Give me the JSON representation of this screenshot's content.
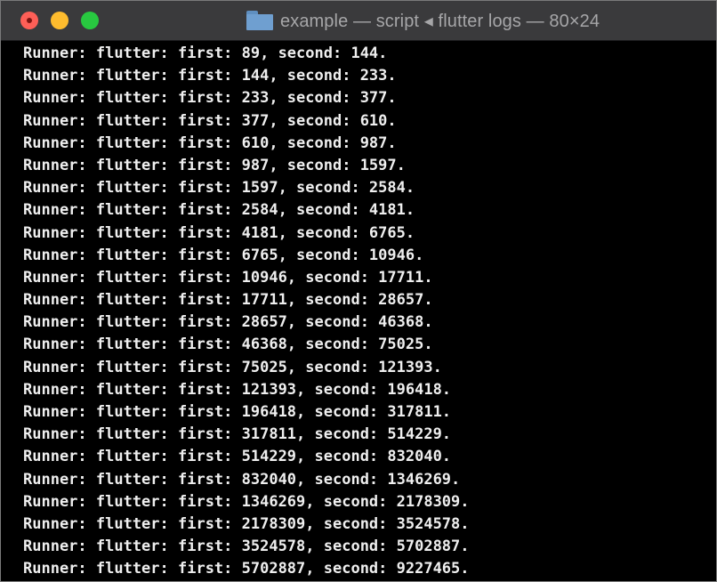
{
  "window": {
    "title": "example — script ◂ flutter logs — 80×24",
    "title_icon": "folder-icon",
    "traffic_lights": {
      "close_color": "#fe5f57",
      "minimize_color": "#febc2e",
      "zoom_color": "#28c840"
    }
  },
  "terminal": {
    "background": "#000000",
    "foreground": "#efefef",
    "lines": [
      "Runner: flutter: first: 89, second: 144.",
      "Runner: flutter: first: 144, second: 233.",
      "Runner: flutter: first: 233, second: 377.",
      "Runner: flutter: first: 377, second: 610.",
      "Runner: flutter: first: 610, second: 987.",
      "Runner: flutter: first: 987, second: 1597.",
      "Runner: flutter: first: 1597, second: 2584.",
      "Runner: flutter: first: 2584, second: 4181.",
      "Runner: flutter: first: 4181, second: 6765.",
      "Runner: flutter: first: 6765, second: 10946.",
      "Runner: flutter: first: 10946, second: 17711.",
      "Runner: flutter: first: 17711, second: 28657.",
      "Runner: flutter: first: 28657, second: 46368.",
      "Runner: flutter: first: 46368, second: 75025.",
      "Runner: flutter: first: 75025, second: 121393.",
      "Runner: flutter: first: 121393, second: 196418.",
      "Runner: flutter: first: 196418, second: 317811.",
      "Runner: flutter: first: 317811, second: 514229.",
      "Runner: flutter: first: 514229, second: 832040.",
      "Runner: flutter: first: 832040, second: 1346269.",
      "Runner: flutter: first: 1346269, second: 2178309.",
      "Runner: flutter: first: 2178309, second: 3524578.",
      "Runner: flutter: first: 3524578, second: 5702887.",
      "Runner: flutter: first: 5702887, second: 9227465."
    ]
  }
}
